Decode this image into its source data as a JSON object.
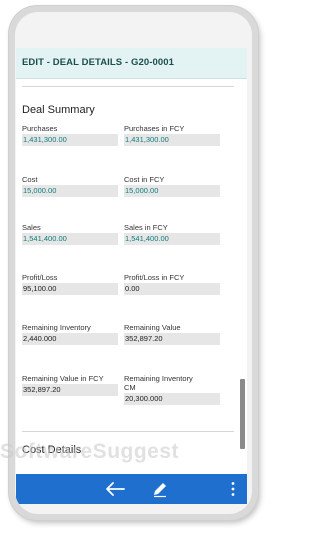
{
  "header": {
    "title": "EDIT - DEAL DETAILS - G20-0001"
  },
  "summary": {
    "title": "Deal Summary",
    "fields": [
      {
        "label": "Purchases",
        "value": "1,431,300.00"
      },
      {
        "label": "Purchases in FCY",
        "value": "1,431,300.00"
      },
      {
        "label": "Cost",
        "value": "15,000.00"
      },
      {
        "label": "Cost in FCY",
        "value": "15,000.00"
      },
      {
        "label": "Sales",
        "value": "1,541,400.00"
      },
      {
        "label": "Sales in FCY",
        "value": "1,541,400.00"
      },
      {
        "label": "Profit/Loss",
        "value": "95,100.00"
      },
      {
        "label": "Profit/Loss in FCY",
        "value": "0.00"
      },
      {
        "label": "Remaining Inventory",
        "value": "2,440.000"
      },
      {
        "label": "Remaining Value",
        "value": "352,897.20"
      },
      {
        "label": "Remaining Value in FCY",
        "value": "352,897.20"
      },
      {
        "label": "Remaining Inventory",
        "label_line2": "CM",
        "value": "20,300.000"
      }
    ]
  },
  "cost_details": {
    "title": "Cost Details"
  },
  "bottom_bar": {
    "back_icon": "arrow-left-icon",
    "edit_icon": "pencil-icon",
    "more_icon": "vertical-ellipsis-icon",
    "color": "#1f6fcf"
  },
  "watermark": {
    "text": "SoftwareSuggest"
  },
  "colors": {
    "header_bg": "#e3f2f2",
    "link_value": "#0f7d7d",
    "field_bg": "#e6e6e6"
  }
}
